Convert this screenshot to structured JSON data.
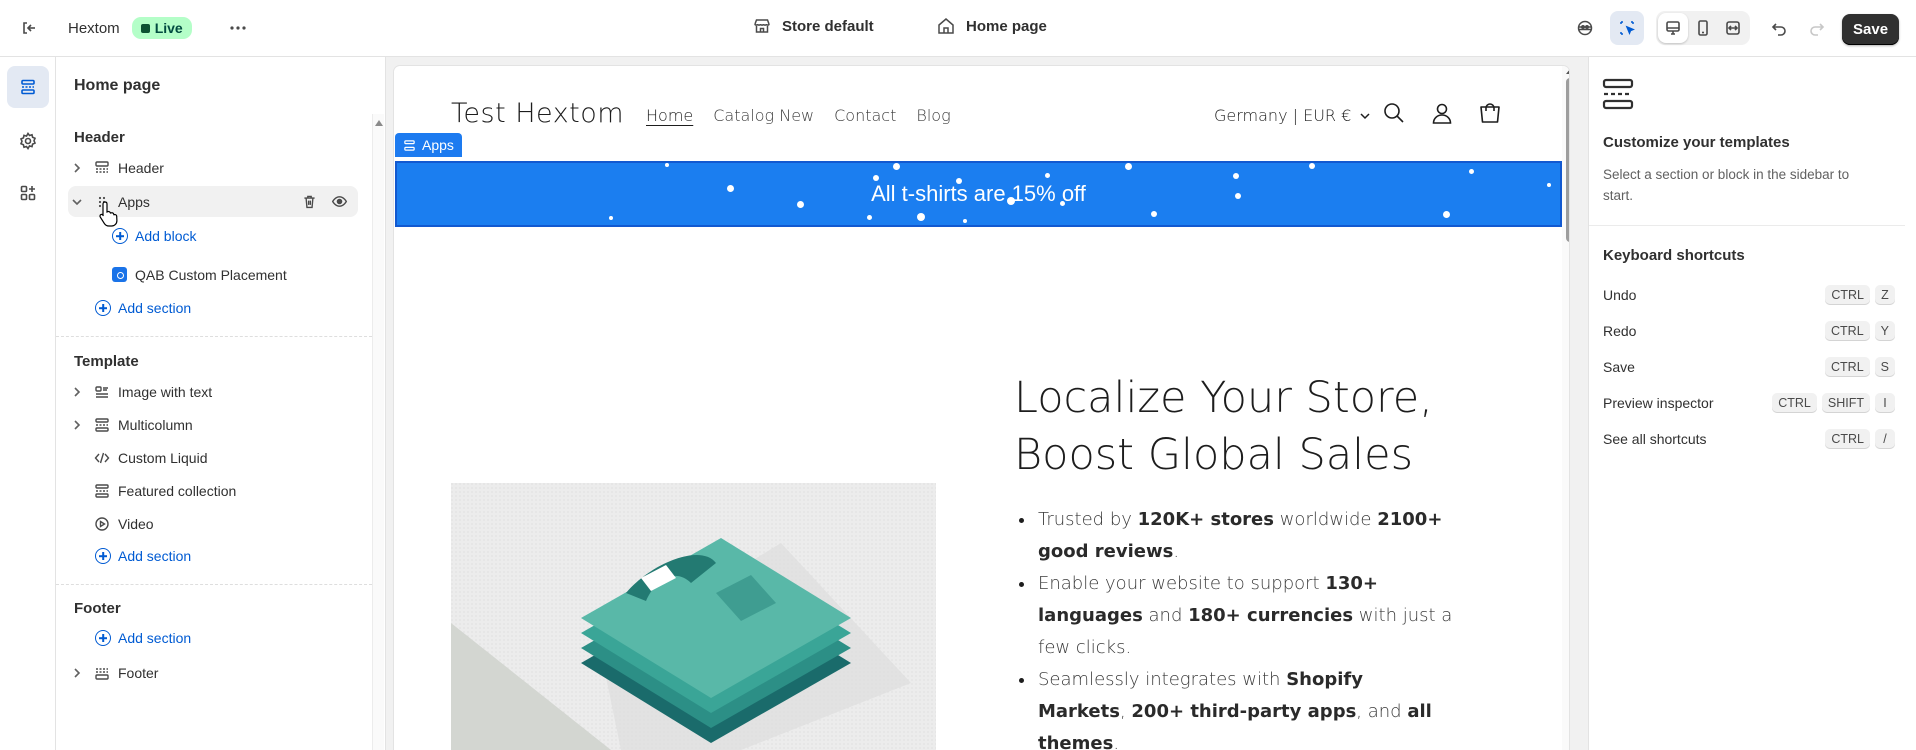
{
  "topbar": {
    "store_name": "Hextom",
    "live_badge": "Live",
    "theme_label": "Store default",
    "page_label": "Home page",
    "save_label": "Save"
  },
  "sidebar": {
    "page_title": "Home page",
    "header_group": {
      "title": "Header",
      "sections": [
        {
          "label": "Header"
        },
        {
          "label": "Apps"
        }
      ],
      "add_block": "Add block",
      "block_label": "QAB Custom Placement",
      "add_section": "Add section"
    },
    "template_group": {
      "title": "Template",
      "sections": [
        {
          "label": "Image with text"
        },
        {
          "label": "Multicolumn"
        },
        {
          "label": "Custom Liquid"
        },
        {
          "label": "Featured collection"
        },
        {
          "label": "Video"
        }
      ],
      "add_section": "Add section"
    },
    "footer_group": {
      "title": "Footer",
      "add_section": "Add section",
      "sections": [
        {
          "label": "Footer"
        }
      ]
    }
  },
  "preview": {
    "store_title": "Test Hextom",
    "nav": [
      "Home",
      "Catalog New",
      "Contact",
      "Blog"
    ],
    "locale": "Germany | EUR €",
    "apps_tag": "Apps",
    "banner_text": "All t-shirts are 15% off",
    "hero_title_line1": "Localize Your Store,",
    "hero_title_line2": "Boost Global Sales",
    "bullets": [
      {
        "parts": [
          {
            "t": "Trusted by ",
            "b": false
          },
          {
            "t": "120K+ stores",
            "b": true
          },
          {
            "t": " worldwide ",
            "b": false
          },
          {
            "t": "2100+ good reviews",
            "b": true
          },
          {
            "t": ".",
            "b": false
          }
        ]
      },
      {
        "parts": [
          {
            "t": "Enable your website to support ",
            "b": false
          },
          {
            "t": "130+ languages",
            "b": true
          },
          {
            "t": " and ",
            "b": false
          },
          {
            "t": "180+ currencies",
            "b": true
          },
          {
            "t": " with just a few clicks.",
            "b": false
          }
        ]
      },
      {
        "parts": [
          {
            "t": "Seamlessly integrates with ",
            "b": false
          },
          {
            "t": "Shopify Markets",
            "b": true
          },
          {
            "t": ", ",
            "b": false
          },
          {
            "t": "200+ third-party apps",
            "b": true
          },
          {
            "t": ", and ",
            "b": false
          },
          {
            "t": "all themes",
            "b": true
          },
          {
            "t": ".",
            "b": false
          }
        ]
      }
    ]
  },
  "right_panel": {
    "title": "Customize your templates",
    "description": "Select a section or block in the sidebar to start.",
    "shortcuts_title": "Keyboard shortcuts",
    "shortcuts": [
      {
        "label": "Undo",
        "keys": [
          "CTRL",
          "Z"
        ]
      },
      {
        "label": "Redo",
        "keys": [
          "CTRL",
          "Y"
        ]
      },
      {
        "label": "Save",
        "keys": [
          "CTRL",
          "S"
        ]
      },
      {
        "label": "Preview inspector",
        "keys": [
          "CTRL",
          "SHIFT",
          "I"
        ]
      },
      {
        "label": "See all shortcuts",
        "keys": [
          "CTRL",
          "/"
        ]
      }
    ]
  },
  "colors": {
    "accent": "#005bd3",
    "live_badge_bg": "#b4fec8",
    "banner_bg": "#1b7ef0",
    "save_bg": "#303030"
  }
}
